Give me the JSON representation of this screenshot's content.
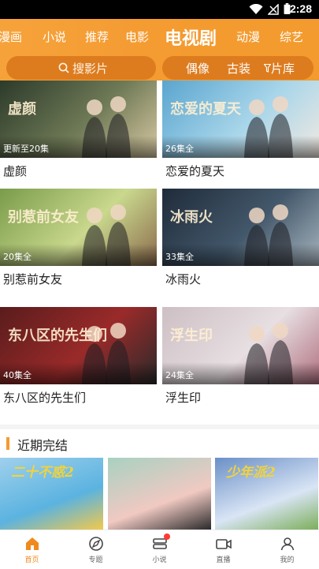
{
  "status_bar": {
    "time": "2:28",
    "icons": [
      "wifi-icon",
      "signal-icon",
      "battery-icon"
    ]
  },
  "top_tabs": [
    {
      "label": "漫画",
      "active": false
    },
    {
      "label": "小说",
      "active": false
    },
    {
      "label": "推荐",
      "active": false
    },
    {
      "label": "电影",
      "active": false
    },
    {
      "label": "电视剧",
      "active": true
    },
    {
      "label": "动漫",
      "active": false
    },
    {
      "label": "综艺",
      "active": false
    }
  ],
  "search": {
    "icon": "search-icon",
    "placeholder": "搜影片"
  },
  "quick_links": [
    "偶像",
    "古装",
    "片库"
  ],
  "quick_filter_icon": "filter-icon",
  "shows": [
    {
      "title": "虚颜",
      "episodes": "更新至20集",
      "colors": [
        "#2c3a2a",
        "#6f7a56",
        "#d8c9a3"
      ],
      "overlay_text": "虚颜"
    },
    {
      "title": "恋爱的夏天",
      "episodes": "26集全",
      "colors": [
        "#5aa5cf",
        "#a9d6ea",
        "#f2e9e0"
      ],
      "overlay_text": "恋爱的夏天"
    },
    {
      "title": "别惹前女友",
      "episodes": "20集全",
      "colors": [
        "#7a9c4a",
        "#c9d88d",
        "#8b6a4c"
      ],
      "overlay_text": "别惹前女友"
    },
    {
      "title": "冰雨火",
      "episodes": "33集全",
      "colors": [
        "#1f2b3a",
        "#43586b",
        "#a8b5bf"
      ],
      "overlay_text": "冰雨火"
    },
    {
      "title": "东八区的先生们",
      "episodes": "40集全",
      "colors": [
        "#5a1c1c",
        "#9a2a2a",
        "#2a2a2a"
      ],
      "overlay_text": "东八区的先生们"
    },
    {
      "title": "浮生印",
      "episodes": "24集全",
      "colors": [
        "#cdbfc4",
        "#e7dfe2",
        "#b07080"
      ],
      "overlay_text": "浮生印"
    }
  ],
  "section": {
    "title": "近期完结"
  },
  "recent": [
    {
      "overlay_text": "二十不惑2",
      "colors": [
        "#9fd0ec",
        "#5bb3e0",
        "#f2c94c"
      ]
    },
    {
      "overlay_text": "",
      "colors": [
        "#a8d1c1",
        "#f0c9c2",
        "#2a2a2a"
      ]
    },
    {
      "overlay_text": "少年派2",
      "colors": [
        "#6a8fc7",
        "#d9e5f5",
        "#7cae5a"
      ]
    }
  ],
  "bottom_nav": [
    {
      "label": "首页",
      "icon": "home-icon",
      "active": true
    },
    {
      "label": "专题",
      "icon": "topic-compass-icon",
      "active": false
    },
    {
      "label": "小说",
      "icon": "book-icon",
      "active": false,
      "badge": true
    },
    {
      "label": "直播",
      "icon": "live-camera-icon",
      "active": false
    },
    {
      "label": "我的",
      "icon": "profile-icon",
      "active": false
    }
  ],
  "colors": {
    "accent": "#f49b31",
    "accent_dark": "#dd7c1f",
    "nav_active": "#f08a1c"
  }
}
